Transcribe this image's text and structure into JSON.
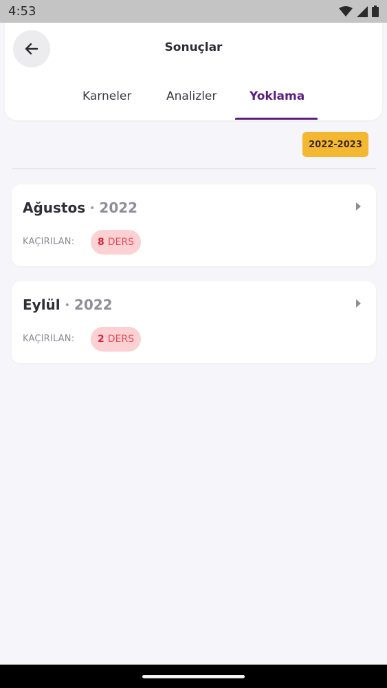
{
  "status_bar": {
    "time": "4:53",
    "icons": [
      "wifi-icon",
      "signal-icon",
      "battery-icon"
    ]
  },
  "header": {
    "back_icon": "arrow-left-icon",
    "title": "Sonuçlar",
    "tabs": [
      {
        "label": "Karneler",
        "active": false
      },
      {
        "label": "Analizler",
        "active": false
      },
      {
        "label": "Yoklama",
        "active": true
      }
    ]
  },
  "year_filter": {
    "label": "2022-2023"
  },
  "months": [
    {
      "name": "Ağustos",
      "separator": "•",
      "year": "2022",
      "missed_label": "KAÇIRILAN:",
      "missed_count": "8",
      "missed_unit": "DERS"
    },
    {
      "name": "Eylül",
      "separator": "•",
      "year": "2022",
      "missed_label": "KAÇIRILAN:",
      "missed_count": "2",
      "missed_unit": "DERS"
    }
  ],
  "colors": {
    "accent": "#5b1d82",
    "badge": "#f4b731",
    "missed_bg": "#fbd1d3",
    "missed_text": "#e94e5b"
  }
}
